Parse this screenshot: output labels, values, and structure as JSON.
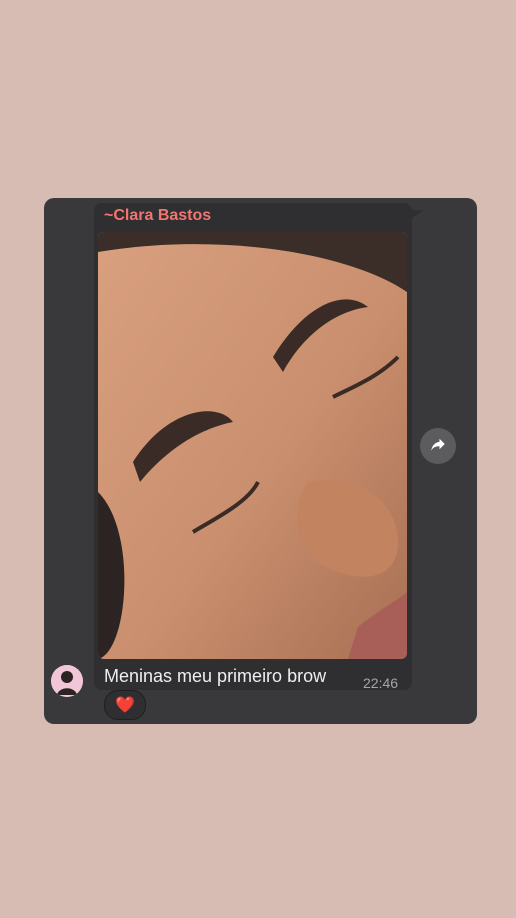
{
  "message": {
    "sender": "~Clara Bastos",
    "text": "Meninas meu primeiro brow",
    "time": "22:46",
    "reaction": "❤️"
  },
  "icons": {
    "forward": "forward-icon",
    "avatar": "avatar",
    "reaction": "heart-icon"
  },
  "colors": {
    "background": "#d6bcb2",
    "card": "#39393b",
    "bubble": "#2f2f31",
    "sender": "#f3756f",
    "caption": "#eeeeee",
    "time": "#a5a5a5"
  }
}
